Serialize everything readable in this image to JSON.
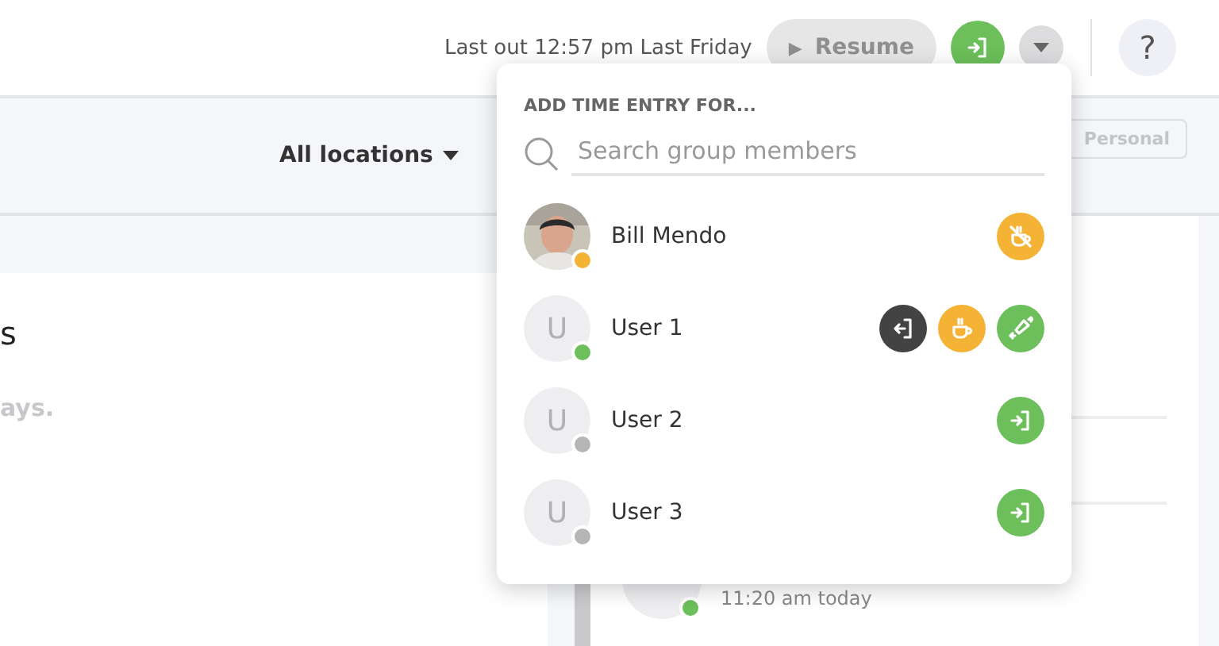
{
  "header": {
    "last_out": "Last out 12:57 pm Last Friday",
    "resume_button": "Resume",
    "resume_icon": "▶",
    "help": "?"
  },
  "filters": {
    "locations": "All locations",
    "personal_button": "Personal"
  },
  "left_pane": {
    "heading": "s",
    "text": "ays."
  },
  "right_pane": {
    "entry_time": "11:20 am today",
    "color": "#6cbf5a"
  },
  "dropdown": {
    "title": "ADD TIME ENTRY FOR...",
    "search": {
      "placeholder": "Search group members"
    },
    "members": [
      {
        "name": "Bill Mendo",
        "color": "#f5b335",
        "actions": [
          {
            "kind": "end-break"
          }
        ]
      },
      {
        "name": "User 1",
        "avatar": {
          "kind": "initial",
          "initial": "U"
        },
        "color": "#6cbf5a",
        "actions": [
          {
            "kind": "clock-out"
          },
          {
            "kind": "break"
          },
          {
            "kind": "switch"
          }
        ]
      },
      {
        "name": "User 2",
        "avatar": {
          "kind": "initial",
          "initial": "U"
        },
        "color": "#b5b5b5",
        "actions": [
          {
            "kind": "clock-in"
          }
        ]
      },
      {
        "name": "User 3",
        "avatar": {
          "kind": "initial",
          "initial": "U"
        },
        "color": "#b5b5b5",
        "actions": [
          {
            "kind": "clock-in"
          }
        ]
      }
    ]
  }
}
